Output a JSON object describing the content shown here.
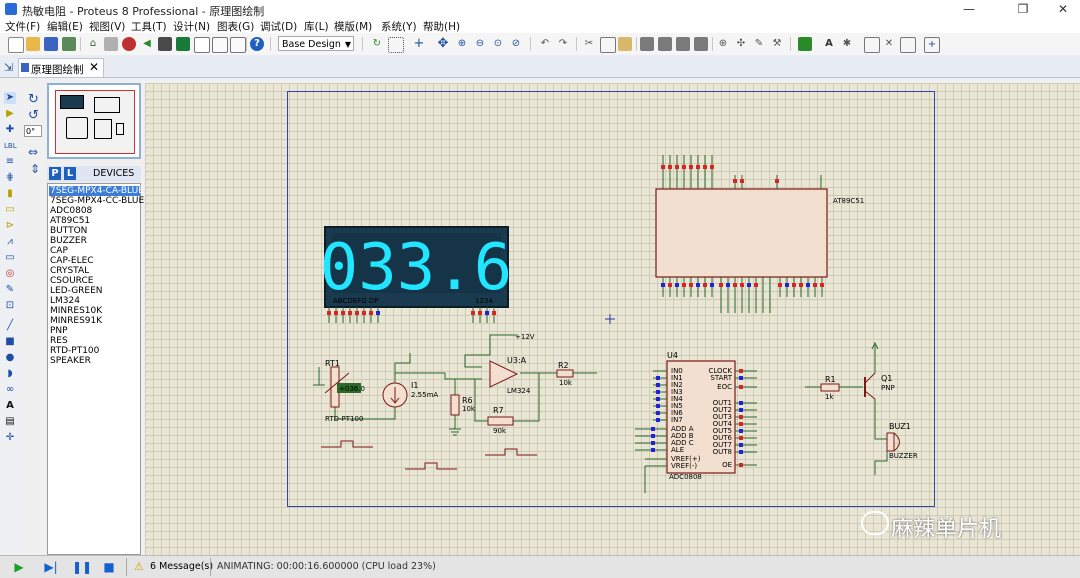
{
  "window": {
    "title": "热敏电阻 - Proteus 8 Professional - 原理图绘制",
    "minimize": "—",
    "maximize": "❐",
    "close": "✕"
  },
  "menu": [
    "文件(F)",
    "编辑(E)",
    "视图(V)",
    "工具(T)",
    "设计(N)",
    "图表(G)",
    "调试(D)",
    "库(L)",
    "模版(M)",
    "系统(Y)",
    "帮助(H)"
  ],
  "toolbar": {
    "style_select": "Base Design"
  },
  "tab": {
    "label": "原理图绘制",
    "close": "✕"
  },
  "rotation": {
    "angle": "0°"
  },
  "panel": {
    "mode_p": "P",
    "mode_l": "L",
    "devices_title": "DEVICES",
    "devices": [
      "7SEG-MPX4-CA-BLUE",
      "7SEG-MPX4-CC-BLUE",
      "ADC0808",
      "AT89C51",
      "BUTTON",
      "BUZZER",
      "CAP",
      "CAP-ELEC",
      "CRYSTAL",
      "CSOURCE",
      "LED-GREEN",
      "LM324",
      "MINRES10K",
      "MINRES91K",
      "PNP",
      "RES",
      "RTD-PT100",
      "SPEAKER"
    ],
    "selected_index": 0
  },
  "schematic": {
    "display_digits": "033.6",
    "display_segments_label": "ABCDEFG DP",
    "display_digits_label": "1234",
    "mcu_name": "AT89C51",
    "rtd_ref": "RT1",
    "rtd_part": "RTD-PT100",
    "rtd_value": "+036.0",
    "current_source_ref": "I1",
    "current_source_value": "2.55mA",
    "r6_ref": "R6",
    "r6_value": "10k",
    "opamp_ref": "U3:A",
    "opamp_part": "LM324",
    "opamp_supply": "+12V",
    "r7_ref": "R7",
    "r7_value": "90k",
    "r2_ref": "R2",
    "r2_value": "10k",
    "adc_ref": "U4",
    "adc_part": "ADC0808",
    "r1_ref": "R1",
    "r1_value": "1k",
    "q1_ref": "Q1",
    "q1_part": "PNP",
    "buzzer_ref": "BUZ1",
    "buzzer_part": "BUZZER",
    "vcc_label": "+12V",
    "adc_left_pins": [
      "IN0",
      "IN1",
      "IN2",
      "IN3",
      "IN4",
      "IN5",
      "IN6",
      "IN7",
      "ADD A",
      "ADD B",
      "ADD C",
      "ALE",
      "VREF(+)",
      "VREF(-)"
    ],
    "adc_right_pins": [
      "CLOCK",
      "START",
      "EOC",
      "OUT1",
      "OUT2",
      "OUT3",
      "OUT4",
      "OUT5",
      "OUT6",
      "OUT7",
      "OUT8",
      "OE"
    ]
  },
  "watermark": "麻辣单片机",
  "status": {
    "messages": "6 Message(s)",
    "animating": "ANIMATING: 00:00:16.600000 (CPU load 23%)"
  },
  "colors": {
    "display_bg": "#1a3a50",
    "display_digits": "#22e5ff",
    "canvas": "#e9e6d6",
    "wire": "#2a6a2a",
    "component_fill": "#f3dfcf",
    "component_stroke": "#7a1818",
    "selected_device": "#3b7dd8"
  }
}
